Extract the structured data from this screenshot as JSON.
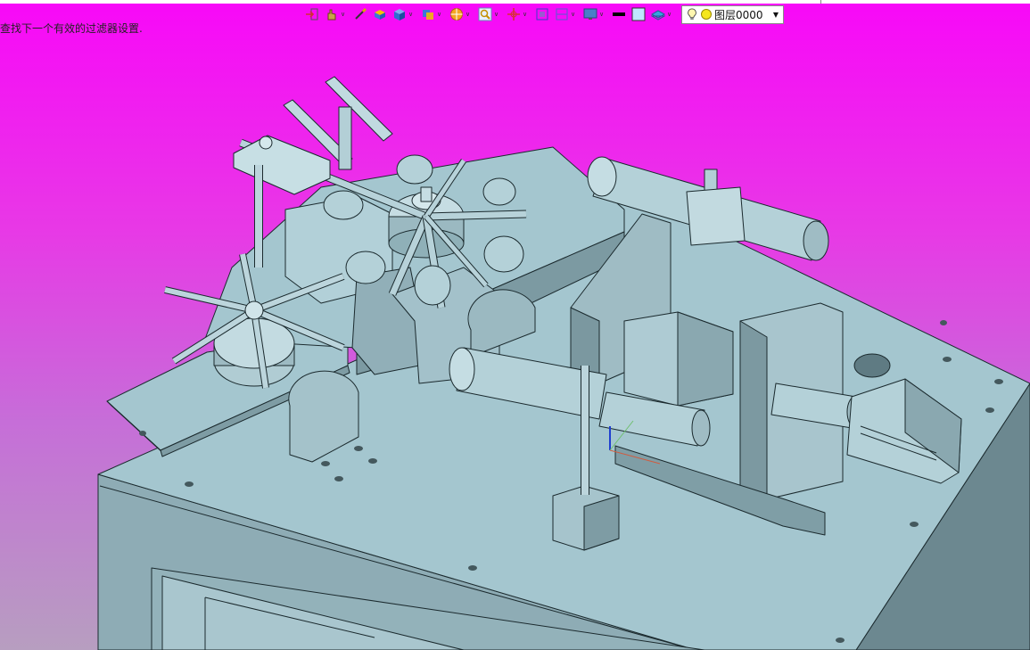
{
  "status": {
    "message": "查找下一个有效的过滤器设置."
  },
  "toolbar": {
    "buttons": [
      {
        "icon": "import-arrow-icon",
        "dropdown": false
      },
      {
        "icon": "pointer-hand-icon",
        "dropdown": true
      },
      {
        "icon": "paint-brush-icon",
        "dropdown": false
      },
      {
        "icon": "box-face-icon",
        "dropdown": false
      },
      {
        "icon": "solid-cube-icon",
        "dropdown": true
      },
      {
        "icon": "render-mode-icon",
        "dropdown": true
      },
      {
        "icon": "color-wheel-icon",
        "dropdown": true
      },
      {
        "icon": "zoom-icon",
        "dropdown": true
      },
      {
        "icon": "crosshair-icon",
        "dropdown": true
      },
      {
        "icon": "fit-view-icon",
        "dropdown": false
      },
      {
        "icon": "section-view-icon",
        "dropdown": true
      },
      {
        "icon": "display-monitor-icon",
        "dropdown": true
      },
      {
        "icon": "line-color-icon",
        "dropdown": false
      },
      {
        "icon": "fill-color-icon",
        "dropdown": false
      },
      {
        "icon": "layers-icon",
        "dropdown": true
      }
    ],
    "layer": {
      "label": "图层0000"
    }
  },
  "colors": {
    "background_top": "#f808f8",
    "background_bottom": "#b79ec0",
    "model_top": "#a4c6cf",
    "model_side": "#7f9ea6",
    "model_dark": "#5d7a82",
    "edge": "#1b2a2e"
  }
}
